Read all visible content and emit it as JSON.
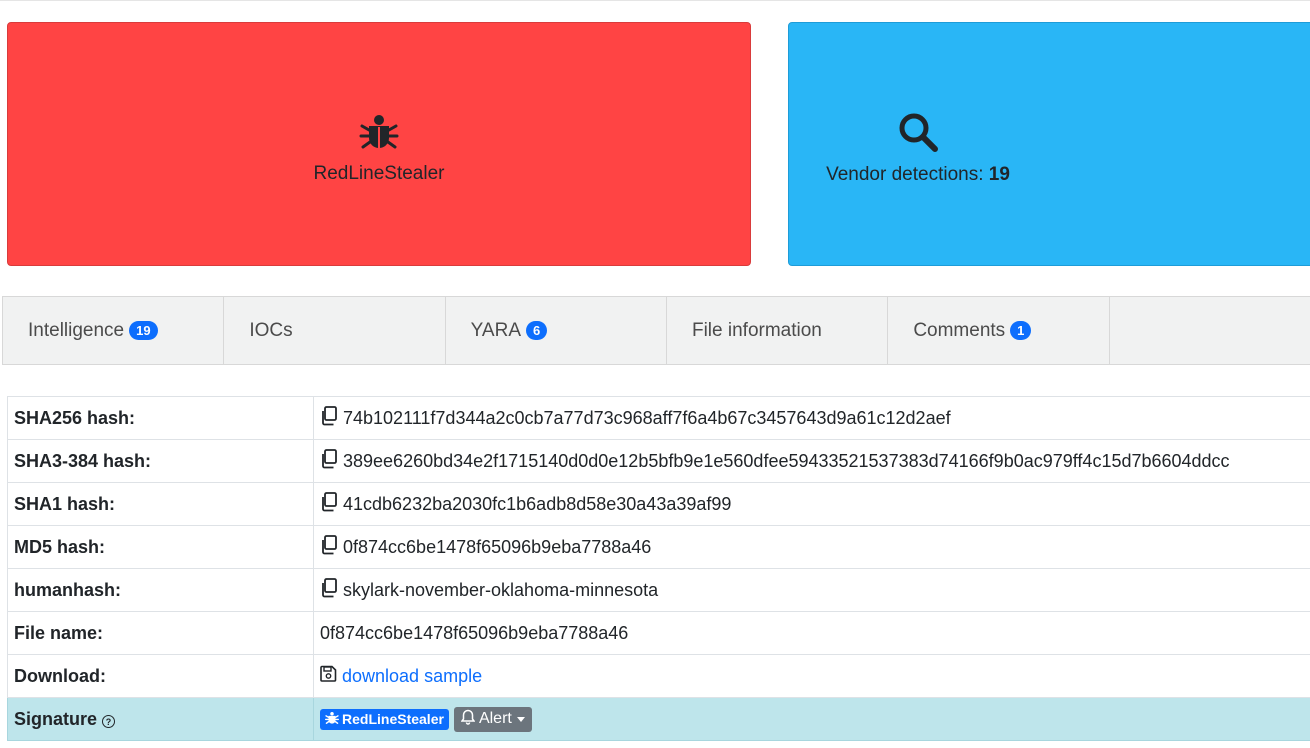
{
  "cards": {
    "signature": {
      "label": "RedLineStealer",
      "icon": "bug-icon",
      "color": "#ff4444"
    },
    "vendor": {
      "label": "Vendor detections: ",
      "count": "19",
      "icon": "search-icon",
      "color": "#29b6f6"
    }
  },
  "tabs": [
    {
      "label": "Intelligence",
      "badge": "19"
    },
    {
      "label": "IOCs",
      "badge": ""
    },
    {
      "label": "YARA",
      "badge": "6"
    },
    {
      "label": "File information",
      "badge": ""
    },
    {
      "label": "Comments",
      "badge": "1"
    }
  ],
  "info": {
    "sha256": {
      "label": "SHA256 hash:",
      "value": "74b102111f7d344a2c0cb7a77d73c968aff7f6a4b67c3457643d9a61c12d2aef"
    },
    "sha3": {
      "label": "SHA3-384 hash:",
      "value": "389ee6260bd34e2f1715140d0d0e12b5bfb9e1e560dfee59433521537383d74166f9b0ac979ff4c15d7b6604ddcc"
    },
    "sha1": {
      "label": "SHA1 hash:",
      "value": "41cdb6232ba2030fc1b6adb8d58e30a43a39af99"
    },
    "md5": {
      "label": "MD5 hash:",
      "value": "0f874cc6be1478f65096b9eba7788a46"
    },
    "humanhash": {
      "label": "humanhash:",
      "value": "skylark-november-oklahoma-minnesota"
    },
    "filename": {
      "label": "File name:",
      "value": "0f874cc6be1478f65096b9eba7788a46"
    },
    "download": {
      "label": "Download:",
      "link": "download sample"
    },
    "signature": {
      "label": "Signature",
      "badge": "RedLineStealer",
      "alert": "Alert"
    }
  }
}
